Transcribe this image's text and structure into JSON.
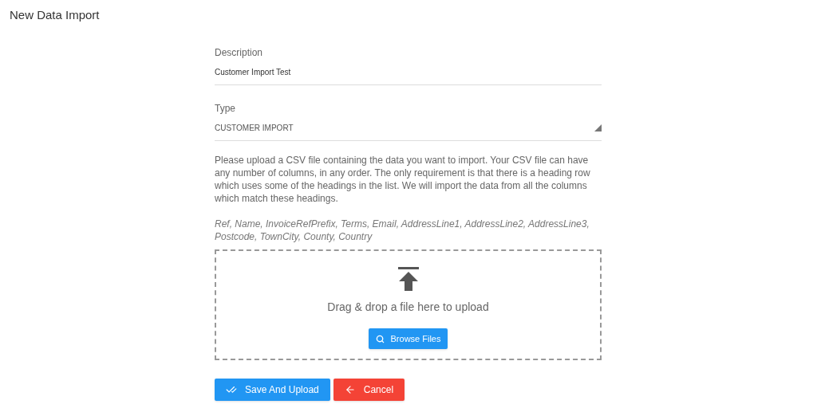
{
  "page_title": "New Data Import",
  "fields": [
    {
      "label": "Description",
      "value": "Customer Import Test",
      "kind": "text"
    },
    {
      "label": "Type",
      "value": "CUSTOMER IMPORT",
      "kind": "select"
    }
  ],
  "instructions": "Please upload a CSV file containing the data you want to import. Your CSV file can have any number of columns, in any order. The only requirement is that there is a heading row which uses some of the headings in the list. We will import the data from all the columns which match these headings.",
  "headings": "Ref, Name, InvoiceRefPrefix, Terms, Email, AddressLine1, AddressLine2, AddressLine3, Postcode, TownCity, County, Country",
  "dropzone": {
    "text": "Drag & drop a file here to upload",
    "button": "Browse Files"
  },
  "actions": [
    {
      "label": "Save And Upload",
      "kind": "primary"
    },
    {
      "label": "Cancel",
      "kind": "danger"
    }
  ]
}
